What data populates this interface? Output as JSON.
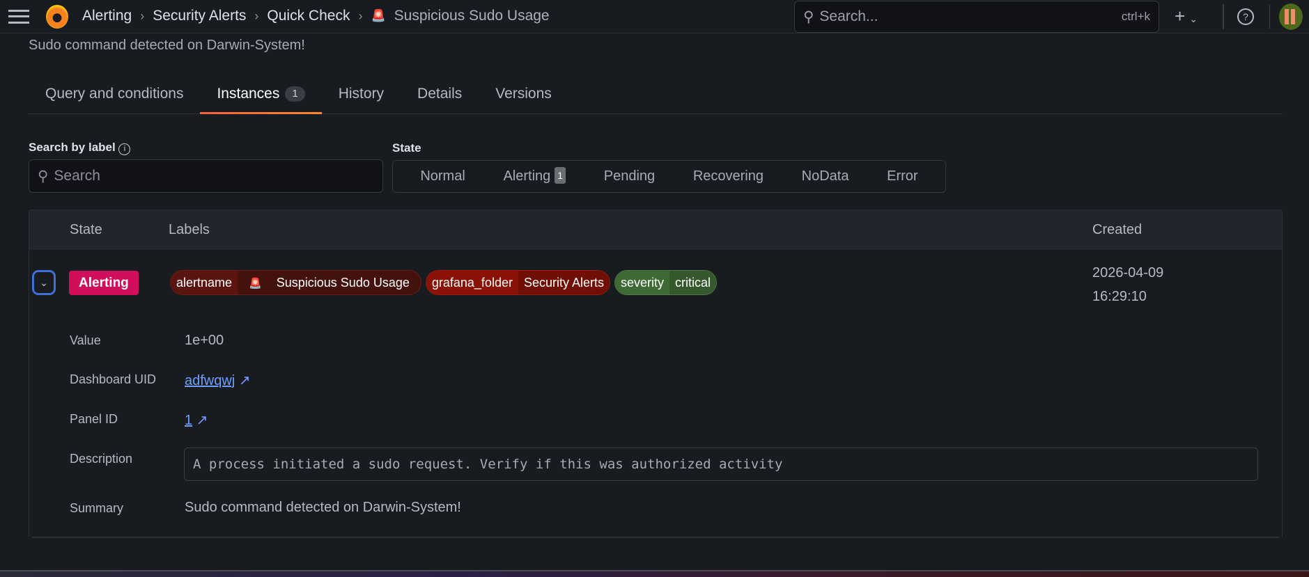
{
  "breadcrumb": [
    "Alerting",
    "Security Alerts",
    "Quick Check",
    "Suspicious Sudo Usage"
  ],
  "search": {
    "placeholder": "Search...",
    "shortcut": "ctrl+k"
  },
  "subtitle": "Sudo command detected on Darwin-System!",
  "tabs": [
    {
      "label": "Query and conditions"
    },
    {
      "label": "Instances",
      "count": "1"
    },
    {
      "label": "History"
    },
    {
      "label": "Details"
    },
    {
      "label": "Versions"
    }
  ],
  "filters": {
    "search_label": "Search by label",
    "search_placeholder": "Search",
    "state_label": "State",
    "states": [
      "Normal",
      "Alerting",
      "Pending",
      "Recovering",
      "NoData",
      "Error"
    ],
    "alerting_count": "1"
  },
  "table": {
    "headers": {
      "state": "State",
      "labels": "Labels",
      "created": "Created"
    },
    "row": {
      "state": "Alerting",
      "labels": [
        {
          "key": "alertname",
          "value": "Suspicious Sudo Usage",
          "keyColor": "#5a1510",
          "valColor": "#44120d"
        },
        {
          "key": "grafana_folder",
          "value": "Security Alerts",
          "keyColor": "#8a1206",
          "valColor": "#6f0f05"
        },
        {
          "key": "severity",
          "value": "critical",
          "keyColor": "#3f6a35",
          "valColor": "#35592c"
        }
      ],
      "created_date": "2026-04-09",
      "created_time": "16:29:10",
      "details": {
        "value_label": "Value",
        "value": "1e+00",
        "dashboard_label": "Dashboard UID",
        "dashboard_uid": "adfwqwj",
        "panel_label": "Panel ID",
        "panel_id": "1",
        "description_label": "Description",
        "description": "A process initiated a sudo request. Verify if this was authorized activity",
        "summary_label": "Summary",
        "summary": "Sudo command detected on Darwin-System!"
      }
    }
  }
}
